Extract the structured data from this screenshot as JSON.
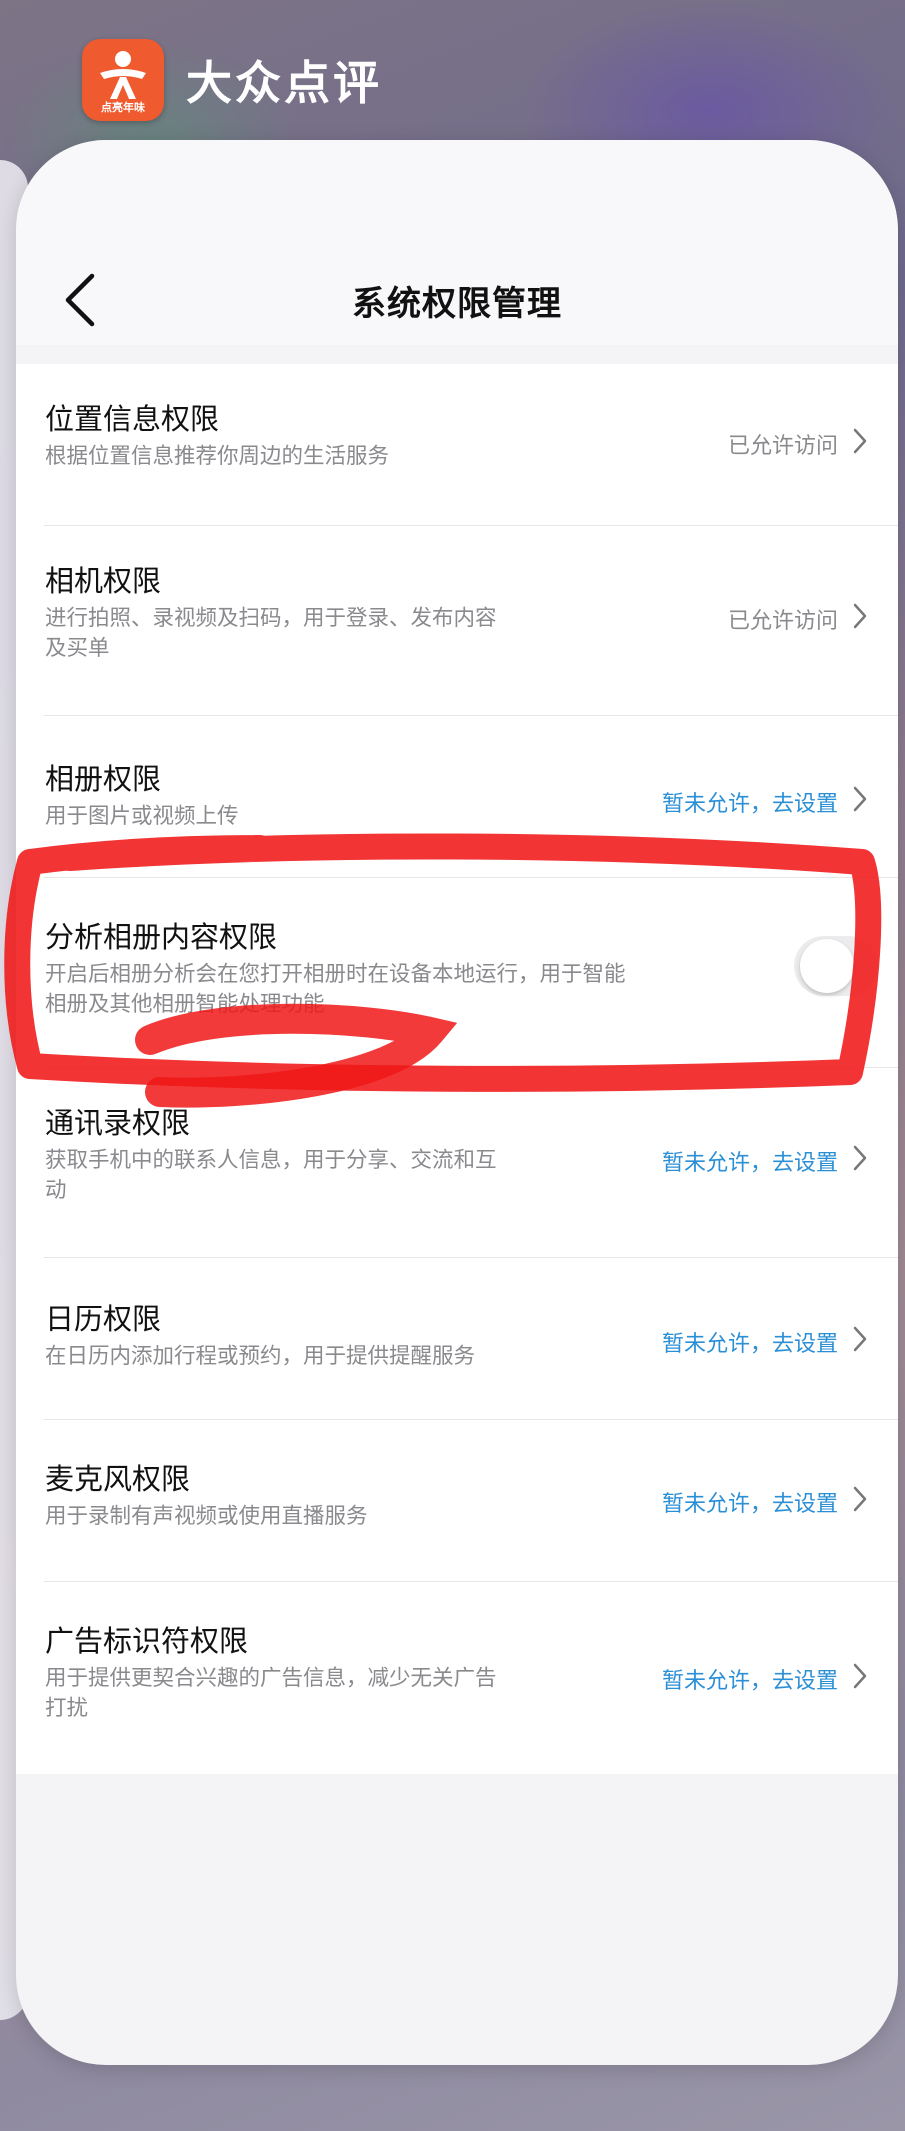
{
  "app": {
    "name": "大众点评",
    "logo_caption": "点亮年味",
    "brand_color": "#ef5a2f"
  },
  "page": {
    "title": "系统权限管理",
    "back_icon": "chevron-left-icon"
  },
  "colors": {
    "status_allowed": "#8a8a8e",
    "status_denied": "#2b8fd6",
    "annotation_red": "#f01818"
  },
  "permissions": [
    {
      "title": "位置信息权限",
      "desc": "根据位置信息推荐你周边的生活服务",
      "status": "已允许访问"
    },
    {
      "title": "相机权限",
      "desc_line1": "进行拍照、录视频及扫码，用于登录、发布内容",
      "desc_line2": "及买单",
      "status": "已允许访问"
    },
    {
      "title": "相册权限",
      "desc": "用于图片或视频上传",
      "status": "暂未允许，去设置"
    },
    {
      "title": "分析相册内容权限",
      "desc_line1": "开启后相册分析会在您打开相册时在设备本地运行，用于智能",
      "desc_line2": "相册及其他相册智能处理功能",
      "toggle_on": false
    },
    {
      "title": "通讯录权限",
      "desc_line1": "获取手机中的联系人信息，用于分享、交流和互",
      "desc_line2": "动",
      "status": "暂未允许，去设置"
    },
    {
      "title": "日历权限",
      "desc": "在日历内添加行程或预约，用于提供提醒服务",
      "status": "暂未允许，去设置"
    },
    {
      "title": "麦克风权限",
      "desc": "用于录制有声视频或使用直播服务",
      "status": "暂未允许，去设置"
    },
    {
      "title": "广告标识符权限",
      "desc_line1": "用于提供更契合兴趣的广告信息，减少无关广告",
      "desc_line2": "打扰",
      "status": "暂未允许，去设置"
    }
  ]
}
